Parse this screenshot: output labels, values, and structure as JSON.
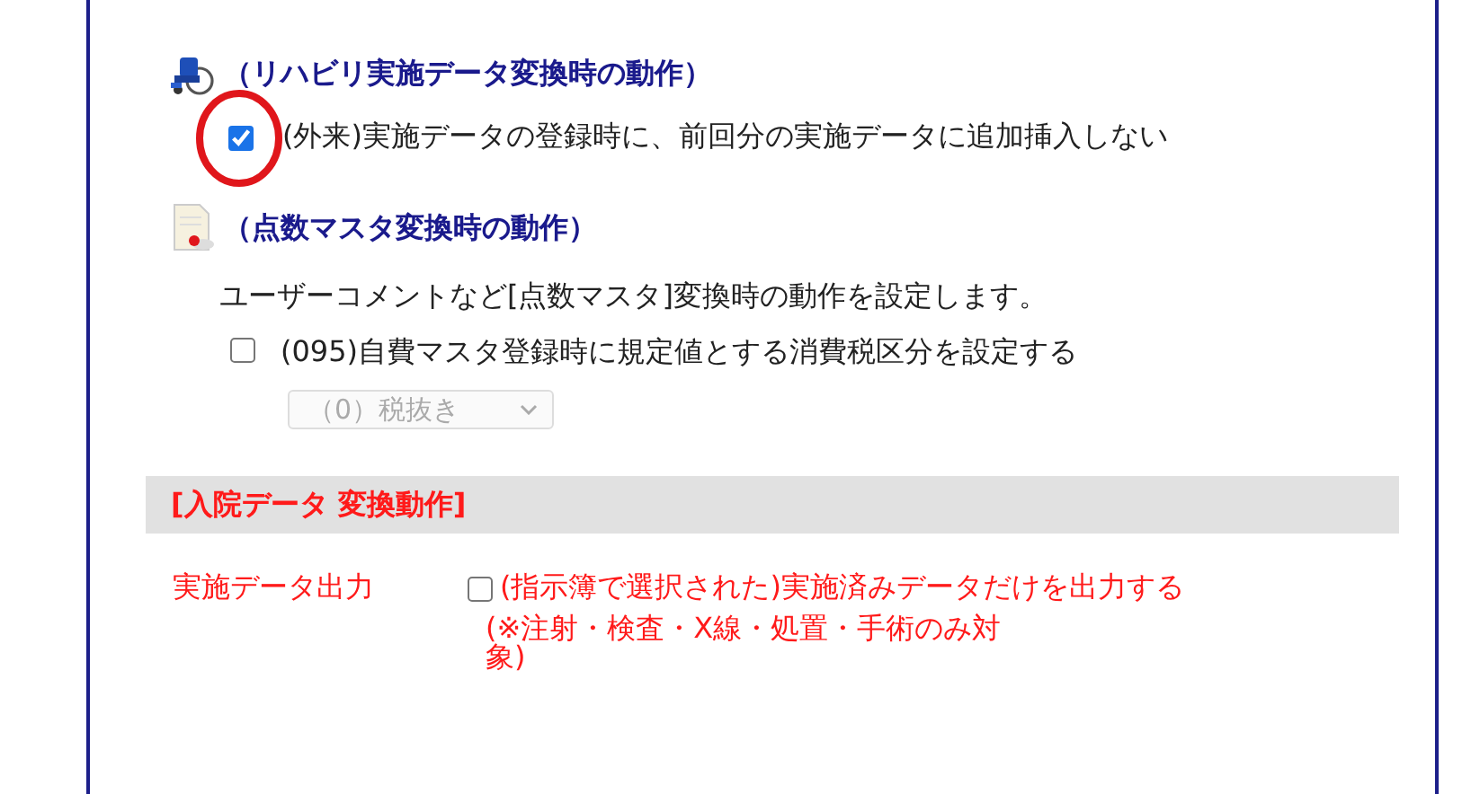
{
  "rehab": {
    "heading": "（リハビリ実施データ変換時の動作）",
    "options": [
      {
        "label": "(外来)実施データの登録時に、前回分の実施データに追加挿入しない",
        "checked": true
      }
    ]
  },
  "points": {
    "heading": "（点数マスタ変換時の動作）",
    "description": "ユーザーコメントなど[点数マスタ]変換時の動作を設定します。",
    "options": [
      {
        "label": "(095)自費マスタ登録時に規定値とする消費税区分を設定する",
        "checked": false
      }
    ],
    "select": {
      "value": "（0）税抜き",
      "disabled": true
    }
  },
  "inpatient": {
    "heading": "[入院データ 変換動作]",
    "rows": [
      {
        "label": "実施データ出力",
        "option": {
          "label": "(指示簿で選択された)実施済みデータだけを出力する",
          "note": "(※注射・検査・X線・処置・手術のみ対象)",
          "checked": false
        }
      }
    ]
  }
}
